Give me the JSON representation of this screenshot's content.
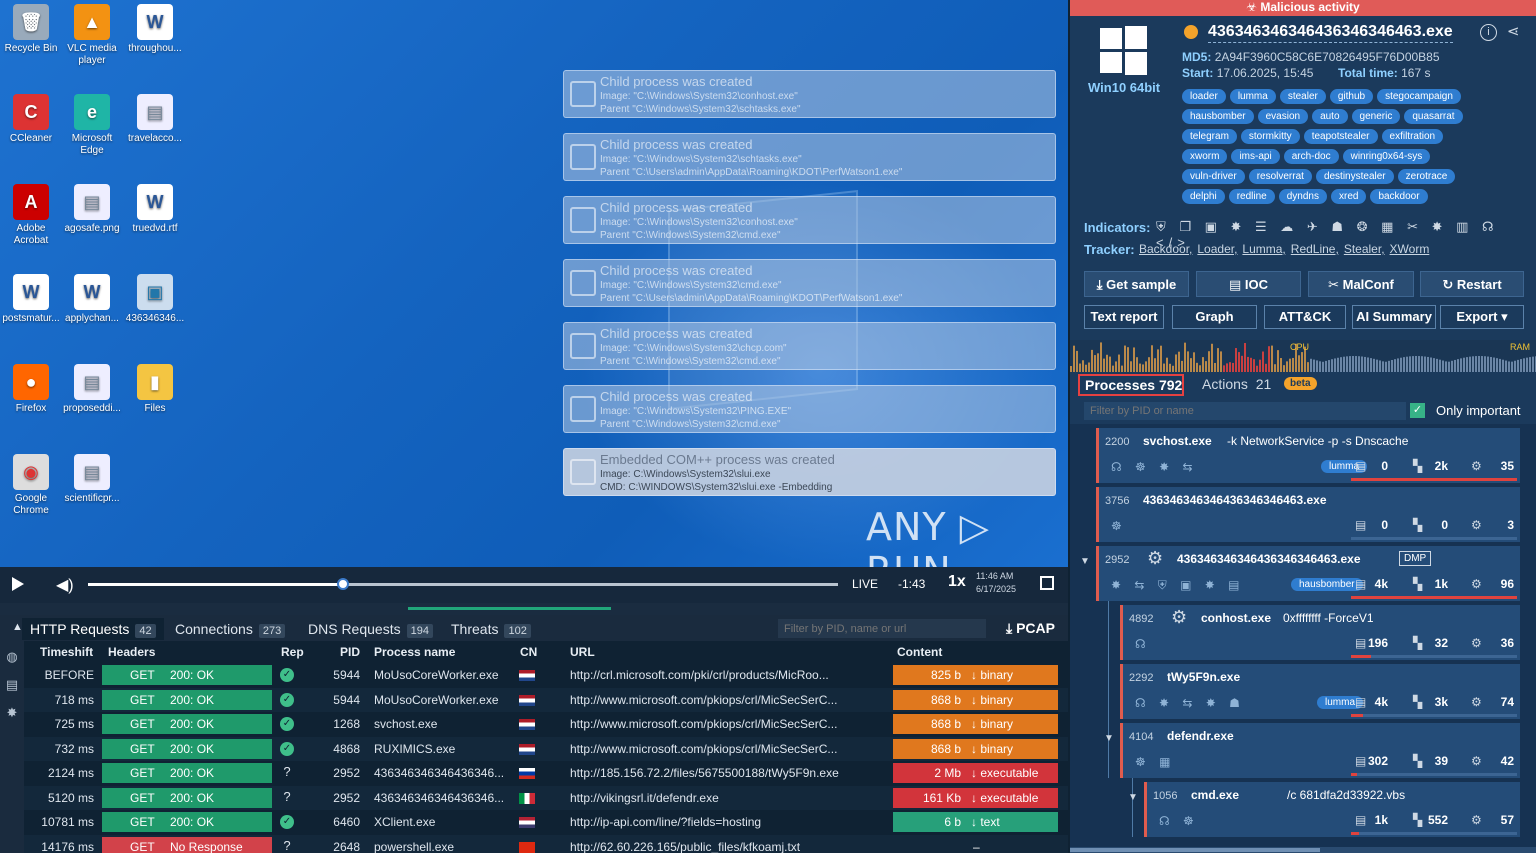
{
  "desktop": {
    "icons": [
      {
        "label": "Recycle Bin",
        "icon": "recycle-bin-icon",
        "glyph": "🗑"
      },
      {
        "label": "VLC media player",
        "icon": "vlc-icon",
        "glyph": "▲"
      },
      {
        "label": "throughou...",
        "icon": "word-doc-icon",
        "glyph": "W"
      },
      {
        "label": "CCleaner",
        "icon": "ccleaner-icon",
        "glyph": "C"
      },
      {
        "label": "Microsoft Edge",
        "icon": "edge-icon",
        "glyph": "e"
      },
      {
        "label": "travelacco...",
        "icon": "document-icon",
        "glyph": "▤"
      },
      {
        "label": "Adobe Acrobat",
        "icon": "acrobat-icon",
        "glyph": "A"
      },
      {
        "label": "agosafe.png",
        "icon": "image-icon",
        "glyph": "▤"
      },
      {
        "label": "truedvd.rtf",
        "icon": "word-doc-icon",
        "glyph": "W"
      },
      {
        "label": "postsmatur...",
        "icon": "word-doc-icon",
        "glyph": "W"
      },
      {
        "label": "applychan...",
        "icon": "word-doc-icon",
        "glyph": "W"
      },
      {
        "label": "436346346...",
        "icon": "exe-icon",
        "glyph": "▣"
      },
      {
        "label": "Firefox",
        "icon": "firefox-icon",
        "glyph": "●"
      },
      {
        "label": "proposeddi...",
        "icon": "document-icon",
        "glyph": "▤"
      },
      {
        "label": "Files",
        "icon": "folder-icon",
        "glyph": "▮"
      },
      {
        "label": "Google Chrome",
        "icon": "chrome-icon",
        "glyph": "◉"
      },
      {
        "label": "scientificpr...",
        "icon": "document-icon",
        "glyph": "▤"
      }
    ],
    "notifications": [
      {
        "title": "Child process was created",
        "l1": "Image: \"C:\\Windows\\System32\\conhost.exe\"",
        "l2": "Parent \"C:\\Windows\\System32\\schtasks.exe\""
      },
      {
        "title": "Child process was created",
        "l1": "Image: \"C:\\Windows\\System32\\schtasks.exe\"",
        "l2": "Parent \"C:\\Users\\admin\\AppData\\Roaming\\KDOT\\PerfWatson1.exe\""
      },
      {
        "title": "Child process was created",
        "l1": "Image: \"C:\\Windows\\System32\\conhost.exe\"",
        "l2": "Parent \"C:\\Windows\\System32\\cmd.exe\""
      },
      {
        "title": "Child process was created",
        "l1": "Image: \"C:\\Windows\\System32\\cmd.exe\"",
        "l2": "Parent \"C:\\Users\\admin\\AppData\\Roaming\\KDOT\\PerfWatson1.exe\""
      },
      {
        "title": "Child process was created",
        "l1": "Image: \"C:\\Windows\\System32\\chcp.com\"",
        "l2": "Parent \"C:\\Windows\\System32\\cmd.exe\""
      },
      {
        "title": "Child process was created",
        "l1": "Image: \"C:\\Windows\\System32\\PING.EXE\"",
        "l2": "Parent \"C:\\Windows\\System32\\cmd.exe\""
      },
      {
        "title": "Embedded COM++ process was created",
        "l1": "Image: C:\\Windows\\System32\\slui.exe",
        "l2": "CMD: C:\\WINDOWS\\System32\\slui.exe -Embedding"
      }
    ],
    "watermark": "ANY ▷ RUN"
  },
  "player": {
    "live": "LIVE",
    "time": "-1:43",
    "speed": "1x",
    "clock_time": "11:46 AM",
    "clock_date": "6/17/2025",
    "progress": 0.34
  },
  "net": {
    "tabs": [
      {
        "label": "HTTP Requests",
        "count": "42"
      },
      {
        "label": "Connections",
        "count": "273"
      },
      {
        "label": "DNS Requests",
        "count": "194"
      },
      {
        "label": "Threats",
        "count": "102"
      }
    ],
    "filter_placeholder": "Filter by PID, name or url",
    "pcap": "⤓ PCAP",
    "headers": {
      "timeshift": "Timeshift",
      "headers": "Headers",
      "rep": "Rep",
      "pid": "PID",
      "process": "Process name",
      "cn": "CN",
      "url": "URL",
      "content": "Content"
    },
    "rows": [
      {
        "ts": "BEFORE",
        "method": "GET",
        "status": "200: OK",
        "rep": "ok",
        "pid": "5944",
        "pn": "MoUsoCoreWorker.exe",
        "cn": "nl",
        "url": "http://crl.microsoft.com/pki/crl/products/MicRoo...",
        "size": "825 b",
        "type": "binary",
        "ct": "bin"
      },
      {
        "ts": "718 ms",
        "method": "GET",
        "status": "200: OK",
        "rep": "ok",
        "pid": "5944",
        "pn": "MoUsoCoreWorker.exe",
        "cn": "nl",
        "url": "http://www.microsoft.com/pkiops/crl/MicSecSerC...",
        "size": "868 b",
        "type": "binary",
        "ct": "bin"
      },
      {
        "ts": "725 ms",
        "method": "GET",
        "status": "200: OK",
        "rep": "ok",
        "pid": "1268",
        "pn": "svchost.exe",
        "cn": "nl",
        "url": "http://www.microsoft.com/pkiops/crl/MicSecSerC...",
        "size": "868 b",
        "type": "binary",
        "ct": "bin"
      },
      {
        "ts": "732 ms",
        "method": "GET",
        "status": "200: OK",
        "rep": "ok",
        "pid": "4868",
        "pn": "RUXIMICS.exe",
        "cn": "nl",
        "url": "http://www.microsoft.com/pkiops/crl/MicSecSerC...",
        "size": "868 b",
        "type": "binary",
        "ct": "bin"
      },
      {
        "ts": "2124 ms",
        "method": "GET",
        "status": "200: OK",
        "rep": "q",
        "pid": "2952",
        "pn": "436346346346436346...",
        "cn": "ru",
        "url": "http://185.156.72.2/files/5675500188/tWy5F9n.exe",
        "size": "2 Mb",
        "type": "executable",
        "ct": "exe"
      },
      {
        "ts": "5120 ms",
        "method": "GET",
        "status": "200: OK",
        "rep": "q",
        "pid": "2952",
        "pn": "436346346346436346...",
        "cn": "it",
        "url": "http://vikingsrl.it/defendr.exe",
        "size": "161 Kb",
        "type": "executable",
        "ct": "exe"
      },
      {
        "ts": "10781 ms",
        "method": "GET",
        "status": "200: OK",
        "rep": "ok",
        "pid": "6460",
        "pn": "XClient.exe",
        "cn": "us",
        "url": "http://ip-api.com/line/?fields=hosting",
        "size": "6 b",
        "type": "text",
        "ct": "txt"
      },
      {
        "ts": "14176 ms",
        "method": "GET",
        "status": "No Response",
        "rep": "q",
        "pid": "2648",
        "pn": "powershell.exe",
        "cn": "hk",
        "url": "http://62.60.226.165/public_files/kfkoamj.txt",
        "size": "",
        "type": "–",
        "ct": "none"
      }
    ]
  },
  "right": {
    "alert": "☣ Malicious activity",
    "filename": "436346346346436346346463.exe",
    "os": "Win10 64bit",
    "md5_label": "MD5:",
    "md5": "2A94F3960C58C6E70826495F76D00B85",
    "start_label": "Start:",
    "start": "17.06.2025, 15:45",
    "total_label": "Total time:",
    "total": "167 s",
    "tag_rows": [
      [
        "loader",
        "lumma",
        "stealer",
        "github",
        "stegocampaign"
      ],
      [
        "hausbomber",
        "evasion",
        "auto",
        "generic",
        "quasarrat"
      ],
      [
        "telegram",
        "stormkitty",
        "teapotstealer",
        "exfiltration"
      ],
      [
        "xworm",
        "ims-api",
        "arch-doc",
        "winring0x64-sys"
      ],
      [
        "vuln-driver",
        "resolverrat",
        "destinystealer",
        "zerotrace"
      ],
      [
        "delphi",
        "redline",
        "dyndns",
        "xred",
        "backdoor"
      ]
    ],
    "indicators_label": "Indicators:",
    "indicator_glyphs": "⛨ ❐ ▣ ✸ ☰ ☁ ✈ ☗ ❂ ▦ ✂ ✸ ▥ ☊ </>",
    "tracker_label": "Tracker:",
    "trackers": [
      "Backdoor,",
      "Loader,",
      "Lumma,",
      "RedLine,",
      "Stealer,",
      "XWorm"
    ],
    "buttons": [
      "⤓ Get sample",
      "▤ IOC",
      "✂ MalConf",
      "↻ Restart"
    ],
    "buttons2": [
      "Text report",
      "Graph",
      "ATT&CK",
      "AI Summary",
      "Export ▾"
    ],
    "graph_cpu": "CPU",
    "graph_ram": "RAM",
    "processes_tab": "Processes 792",
    "actions_tab": "Actions",
    "actions_count": "21",
    "beta": "beta",
    "filter_placeholder": "Filter by PID or name",
    "only_important": "Only important",
    "processes": [
      {
        "pid": "2200",
        "name": "svchost.exe",
        "args": "-k NetworkService -p -s Dnscache",
        "badge": "lumma",
        "s1": "0",
        "s2": "2k",
        "s3": "35",
        "indent": 0
      },
      {
        "pid": "3756",
        "name": "436346346346436346346463.exe",
        "args": "",
        "badge": "",
        "s1": "0",
        "s2": "0",
        "s3": "3",
        "indent": 0
      },
      {
        "pid": "2952",
        "name": "436346346346436346346463.exe",
        "args": "",
        "badge": "hausbomber",
        "dmp": "DMP",
        "s1": "4k",
        "s2": "1k",
        "s3": "96",
        "indent": 0
      },
      {
        "pid": "4892",
        "name": "conhost.exe",
        "args": "0xffffffff -ForceV1",
        "badge": "",
        "s1": "196",
        "s2": "32",
        "s3": "36",
        "indent": 1
      },
      {
        "pid": "2292",
        "name": "tWy5F9n.exe",
        "args": "",
        "badge": "lumma",
        "s1": "4k",
        "s2": "3k",
        "s3": "74",
        "indent": 1
      },
      {
        "pid": "4104",
        "name": "defendr.exe",
        "args": "",
        "badge": "",
        "s1": "302",
        "s2": "39",
        "s3": "42",
        "indent": 1
      },
      {
        "pid": "1056",
        "name": "cmd.exe",
        "args": "/c 681dfa2d33922.vbs",
        "badge": "",
        "s1": "1k",
        "s2": "552",
        "s3": "57",
        "indent": 2
      }
    ]
  }
}
